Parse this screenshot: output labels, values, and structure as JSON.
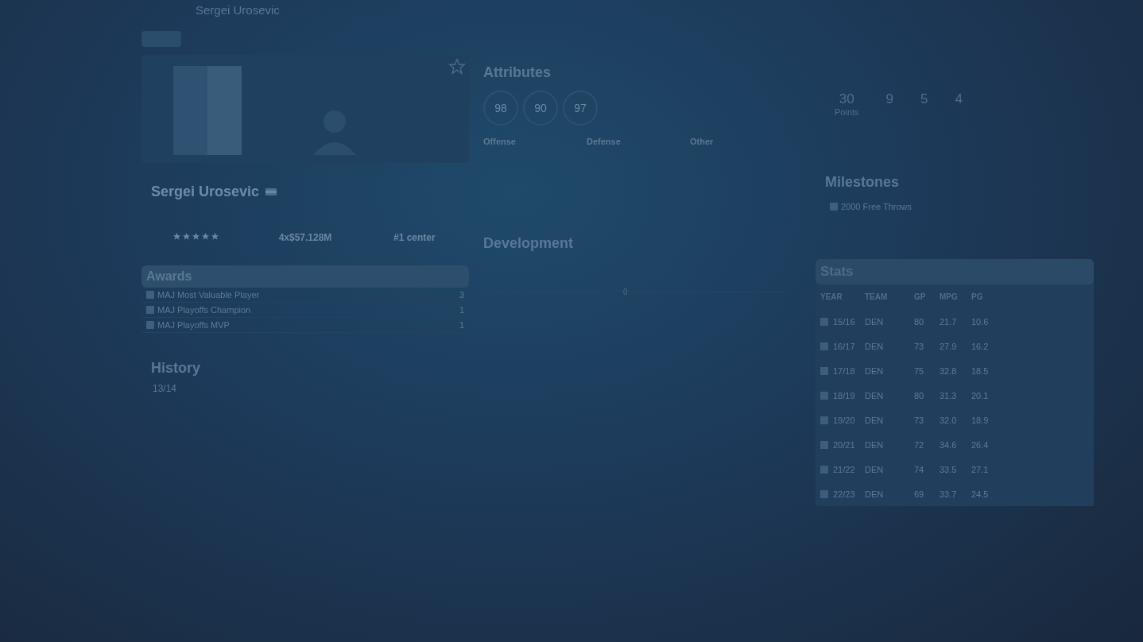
{
  "header": {
    "title": "Sergei Urosevic"
  },
  "player": {
    "name": "Sergei Urosevic",
    "favorite": false,
    "stars": 5,
    "contract": "4x$57.128M",
    "rank": "#1 center"
  },
  "awards": {
    "title": "Awards",
    "items": [
      {
        "label": "MAJ Most Valuable Player",
        "count": "3"
      },
      {
        "label": "MAJ Playoffs Champion",
        "count": "1"
      },
      {
        "label": "MAJ Playoffs MVP",
        "count": "1"
      }
    ]
  },
  "history": {
    "title": "History",
    "season": "13/14"
  },
  "attributes": {
    "title": "Attributes",
    "ratings": [
      "98",
      "90",
      "97"
    ],
    "groups": [
      "Offense",
      "Defense",
      "Other"
    ]
  },
  "development": {
    "title": "Development",
    "axis_label": "0"
  },
  "career_highs": {
    "values": [
      "30",
      "9",
      "5",
      "4"
    ],
    "first_label": "Points"
  },
  "milestones": {
    "title": "Milestones",
    "items": [
      "2000 Free Throws"
    ]
  },
  "stats": {
    "title": "Stats",
    "columns": [
      "YEAR",
      "TEAM",
      "GP",
      "MPG",
      "PG"
    ],
    "rows": [
      [
        "15/16",
        "DEN",
        "80",
        "21.7",
        "10.6"
      ],
      [
        "16/17",
        "DEN",
        "73",
        "27.9",
        "16.2"
      ],
      [
        "17/18",
        "DEN",
        "75",
        "32.8",
        "18.5"
      ],
      [
        "18/19",
        "DEN",
        "80",
        "31.3",
        "20.1"
      ],
      [
        "19/20",
        "DEN",
        "73",
        "32.0",
        "18.9"
      ],
      [
        "20/21",
        "DEN",
        "72",
        "34.6",
        "26.4"
      ],
      [
        "21/22",
        "DEN",
        "74",
        "33.5",
        "27.1"
      ],
      [
        "22/23",
        "DEN",
        "69",
        "33.7",
        "24.5"
      ]
    ]
  }
}
